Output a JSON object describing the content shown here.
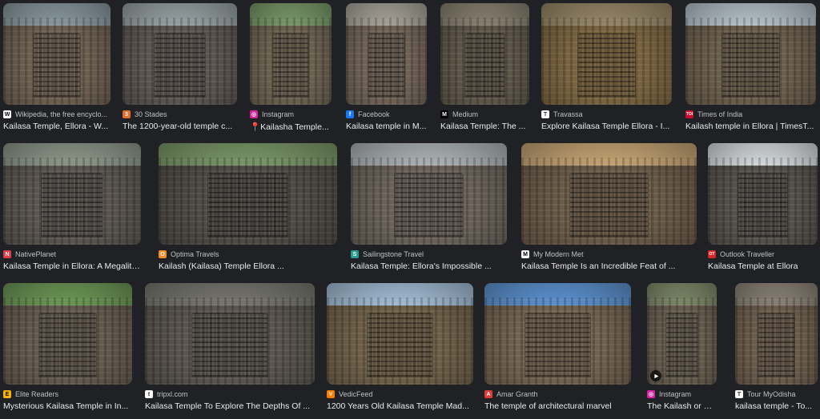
{
  "results": [
    {
      "source": "Wikipedia, the free encyclo...",
      "title": "Kailasa Temple, Ellora - W...",
      "icon": "wikipedia-icon",
      "fav_text": "W",
      "fav_color": "#ffffff",
      "fav_fg": "#000000",
      "sky": "#8a9aa0",
      "tone": "#6b5f50"
    },
    {
      "source": "30 Stades",
      "title": "The 1200-year-old temple c...",
      "icon": "30-stades-icon",
      "fav_text": "3",
      "fav_color": "#e0702a",
      "fav_fg": "#ffffff",
      "sky": "#9aa4a6",
      "tone": "#5d5550"
    },
    {
      "source": "Instagram",
      "title": "📍Kailasha Temple...",
      "icon": "instagram-icon",
      "fav_text": "◎",
      "fav_color": "#d6249f",
      "fav_fg": "#ffffff",
      "sky": "#7a9a6a",
      "tone": "#6a604f"
    },
    {
      "source": "Facebook",
      "title": "Kailasa temple in M...",
      "icon": "facebook-icon",
      "fav_text": "f",
      "fav_color": "#1877f2",
      "fav_fg": "#ffffff",
      "sky": "#a8a49a",
      "tone": "#6e6255"
    },
    {
      "source": "Medium",
      "title": "Kailasa Temple: The ...",
      "icon": "medium-icon",
      "fav_text": "M",
      "fav_color": "#000000",
      "fav_fg": "#ffffff",
      "sky": "#8a8272",
      "tone": "#5e5648"
    },
    {
      "source": "Travassa",
      "title": "Explore Kailasa Temple Ellora - I...",
      "icon": "travassa-icon",
      "fav_text": "T",
      "fav_color": "#ffffff",
      "fav_fg": "#333333",
      "sky": "#9a8a6a",
      "tone": "#7a6440"
    },
    {
      "source": "Times of India",
      "title": "Kailash temple in Ellora | TimesT...",
      "icon": "times-of-india-icon",
      "fav_text": "TOI",
      "fav_color": "#c8102e",
      "fav_fg": "#ffffff",
      "sky": "#b8c4cc",
      "tone": "#6a5e4c"
    },
    {
      "source": "NativePlanet",
      "title": "Kailasa Temple in Ellora: A Megalith...",
      "icon": "nativeplanet-icon",
      "fav_text": "N",
      "fav_color": "#e63946",
      "fav_fg": "#ffffff",
      "sky": "#8f9a8c",
      "tone": "#5a5550"
    },
    {
      "source": "Optima Travels",
      "title": "Kailash (Kailasa) Temple Ellora ...",
      "icon": "optima-travels-icon",
      "fav_text": "O",
      "fav_color": "#f28c28",
      "fav_fg": "#ffffff",
      "sky": "#7d9a6a",
      "tone": "#4f4b45"
    },
    {
      "source": "Sailingstone Travel",
      "title": "Kailasa Temple: Ellora's Impossible ...",
      "icon": "sailingstone-icon",
      "fav_text": "S",
      "fav_color": "#2a9d8f",
      "fav_fg": "#ffffff",
      "sky": "#b0b6b8",
      "tone": "#6a625a"
    },
    {
      "source": "My Modern Met",
      "title": "Kailasa Temple Is an Incredible Feat of ...",
      "icon": "my-modern-met-icon",
      "fav_text": "M",
      "fav_color": "#ffffff",
      "fav_fg": "#000000",
      "sky": "#c9a776",
      "tone": "#6a5a48"
    },
    {
      "source": "Outlook Traveller",
      "title": "Kailasa Temple at Ellora",
      "icon": "outlook-traveller-icon",
      "fav_text": "OT",
      "fav_color": "#d62828",
      "fav_fg": "#ffffff",
      "sky": "#d8dde0",
      "tone": "#54504a"
    },
    {
      "source": "Elite Readers",
      "title": "Mysterious Kailasa Temple in In...",
      "icon": "elite-readers-icon",
      "fav_text": "E",
      "fav_color": "#f4b400",
      "fav_fg": "#000000",
      "sky": "#6f9a58",
      "tone": "#645a4e"
    },
    {
      "source": "tripxl.com",
      "title": "Kailasa Temple To Explore The Depths Of ...",
      "icon": "tripxl-icon",
      "fav_text": "t",
      "fav_color": "#ffffff",
      "fav_fg": "#333333",
      "sky": "#7a7a72",
      "tone": "#5a554e"
    },
    {
      "source": "VedicFeed",
      "title": "1200 Years Old Kailasa Temple Mad...",
      "icon": "vedicfeed-icon",
      "fav_text": "V",
      "fav_color": "#ff7a00",
      "fav_fg": "#ffffff",
      "sky": "#a6c0d8",
      "tone": "#6e6048"
    },
    {
      "source": "Amar Granth",
      "title": "The temple of architectural marvel",
      "icon": "amar-granth-icon",
      "fav_text": "A",
      "fav_color": "#e53935",
      "fav_fg": "#ffffff",
      "sky": "#5f95d4",
      "tone": "#726250"
    },
    {
      "source": "Instagram",
      "title": "The Kailash or Kail...",
      "icon": "instagram-icon",
      "fav_text": "◎",
      "fav_color": "#d6249f",
      "fav_fg": "#ffffff",
      "sky": "#7f8a6a",
      "tone": "#665c4e"
    },
    {
      "source": "Tour MyOdisha",
      "title": "kailasa temple - To...",
      "icon": "tour-myodisha-icon",
      "fav_text": "T",
      "fav_color": "#ffffff",
      "fav_fg": "#333333",
      "sky": "#8c8478",
      "tone": "#6a5c4c"
    }
  ],
  "video_badge_icon": "play-icon"
}
